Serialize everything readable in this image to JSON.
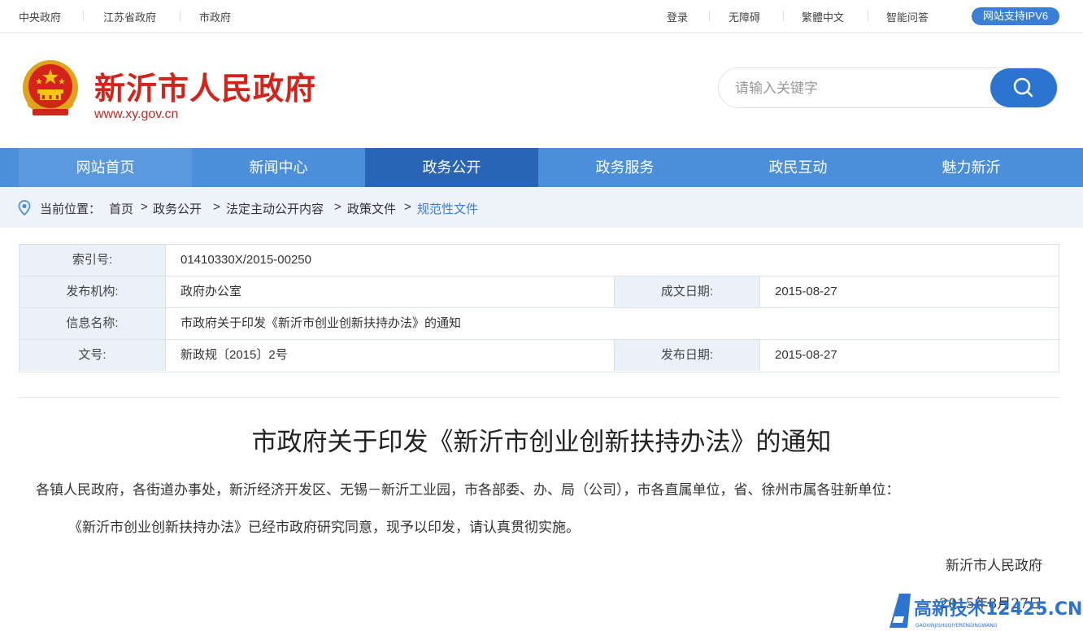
{
  "topbar": {
    "links_left": [
      "中央政府",
      "江苏省政府",
      "市政府"
    ],
    "links_right": [
      "登录",
      "无障碍",
      "繁體中文",
      "智能问答"
    ],
    "ipv6": "网站支持IPV6"
  },
  "header": {
    "title": "新沂市人民政府",
    "url": "www.xy.gov.cn",
    "search_placeholder": "请输入关键字"
  },
  "nav": {
    "items": [
      "网站首页",
      "新闻中心",
      "政务公开",
      "政务服务",
      "政民互动",
      "魅力新沂"
    ],
    "active": "政务公开"
  },
  "breadcrumb": {
    "label": "当前位置：",
    "items": [
      "首页",
      "政务公开",
      "法定主动公开内容",
      "政策文件"
    ],
    "current": "规范性文件",
    "separator": ">"
  },
  "info": {
    "index_label": "索引号:",
    "index_value": "01410330X/2015-00250",
    "org_label": "发布机构:",
    "org_value": "政府办公室",
    "created_label": "成文日期:",
    "created_value": "2015-08-27",
    "name_label": "信息名称:",
    "name_value": "市政府关于印发《新沂市创业创新扶持办法》的通知",
    "docno_label": "文号:",
    "docno_value": "新政规〔2015〕2号",
    "published_label": "发布日期:",
    "published_value": "2015-08-27"
  },
  "document": {
    "title": "市政府关于印发《新沂市创业创新扶持办法》的通知",
    "salutation": "各镇人民政府，各街道办事处，新沂经济开发区、无锡－新沂工业园，市各部委、办、局（公司），市各直属单位，省、徐州市属各驻新单位：",
    "body": "《新沂市创业创新扶持办法》已经市政府研究同意，现予以印发，请认真贯彻实施。",
    "signature": "新沂市人民政府",
    "date": "2015年8月27日"
  },
  "watermark": {
    "text": "高新技术12425.CN",
    "subtext": "GAOXINJISHUQIYERENDINGWANG"
  },
  "colors": {
    "nav_bg": "#4b8ed9",
    "nav_active": "#2965b4",
    "brand_red": "#d4231b",
    "accent_blue": "#3a7fd5"
  }
}
